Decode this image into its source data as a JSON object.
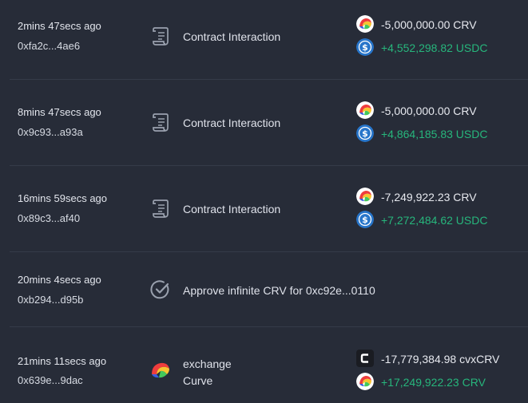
{
  "transactions": [
    {
      "time": "2mins 47secs ago",
      "hash": "0xfa2c...4ae6",
      "method": {
        "icon": "contract-scroll-icon",
        "label": "Contract Interaction"
      },
      "transfers": [
        {
          "icon": "crv-token-icon",
          "amount": "-5,000,000.00 CRV",
          "direction": "out"
        },
        {
          "icon": "usdc-token-icon",
          "amount": "+4,552,298.82 USDC",
          "direction": "in"
        }
      ]
    },
    {
      "time": "8mins 47secs ago",
      "hash": "0x9c93...a93a",
      "method": {
        "icon": "contract-scroll-icon",
        "label": "Contract Interaction"
      },
      "transfers": [
        {
          "icon": "crv-token-icon",
          "amount": "-5,000,000.00 CRV",
          "direction": "out"
        },
        {
          "icon": "usdc-token-icon",
          "amount": "+4,864,185.83 USDC",
          "direction": "in"
        }
      ]
    },
    {
      "time": "16mins 59secs ago",
      "hash": "0x89c3...af40",
      "method": {
        "icon": "contract-scroll-icon",
        "label": "Contract Interaction"
      },
      "transfers": [
        {
          "icon": "crv-token-icon",
          "amount": "-7,249,922.23 CRV",
          "direction": "out"
        },
        {
          "icon": "usdc-token-icon",
          "amount": "+7,272,484.62 USDC",
          "direction": "in"
        }
      ]
    },
    {
      "time": "20mins 4secs ago",
      "hash": "0xb294...d95b",
      "method": {
        "icon": "approve-check-icon",
        "label": "Approve infinite CRV for 0xc92e...0110"
      },
      "transfers": []
    },
    {
      "time": "21mins 11secs ago",
      "hash": "0x639e...9dac",
      "method": {
        "icon": "curve-logo-icon",
        "label": "exchange",
        "sublabel": "Curve"
      },
      "transfers": [
        {
          "icon": "cvxcrv-token-icon",
          "amount": "-17,779,384.98 cvxCRV",
          "direction": "out"
        },
        {
          "icon": "crv-token-icon",
          "amount": "+17,249,922.23 CRV",
          "direction": "in"
        }
      ]
    }
  ],
  "colors": {
    "background": "#272c38",
    "separator": "#353b49",
    "positive": "#27b67c",
    "usdc": "#2775ca"
  }
}
